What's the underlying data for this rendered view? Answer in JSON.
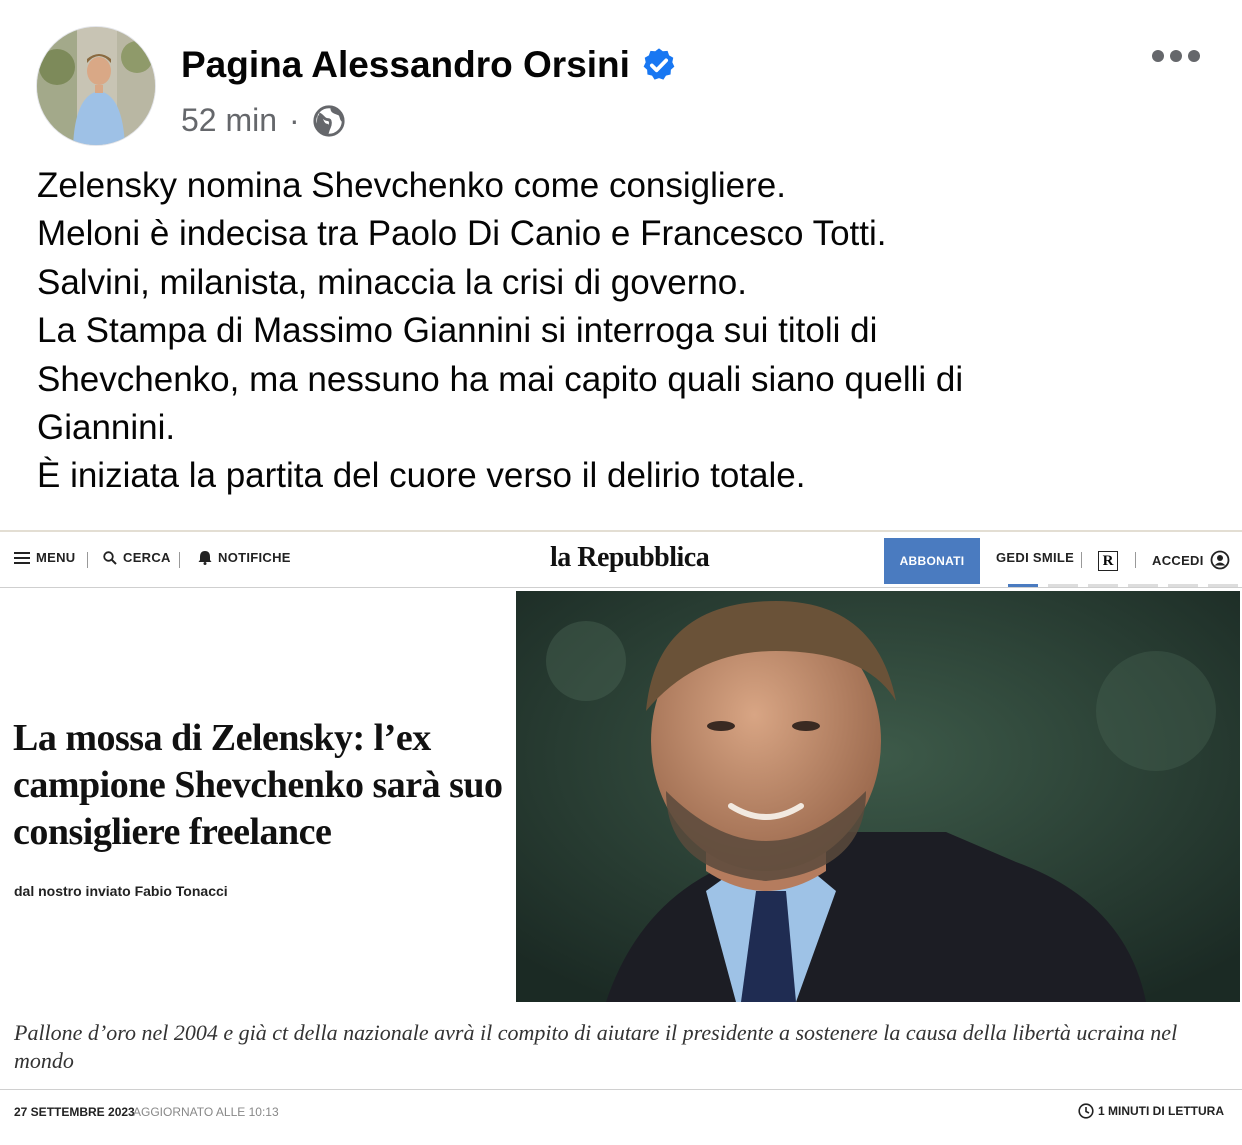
{
  "post": {
    "author": "Pagina Alessandro Orsini",
    "time": "52 min",
    "separator": "·",
    "privacy_icon": "globe-icon",
    "more_icon": "more-options-icon",
    "lines": [
      "Zelensky nomina Shevchenko come consigliere.",
      "Meloni è indecisa tra Paolo Di Canio e Francesco Totti.",
      "Salvini, milanista, minaccia la crisi di governo.",
      "La Stampa di Massimo Giannini si interroga sui titoli di",
      "Shevchenko, ma nessuno ha mai capito quali siano quelli di",
      "Giannini.",
      "È iniziata la partita del cuore verso il delirio totale."
    ]
  },
  "article": {
    "nav": {
      "menu": "MENU",
      "search": "CERCA",
      "notifications": "NOTIFICHE",
      "logo": "la Repubblica",
      "subscribe": "ABBONATI",
      "gedi": "GEDI SMILE",
      "r_badge": "R",
      "login": "ACCEDI"
    },
    "headline": "La mossa di Zelensky: l’ex campione Shevchenko sarà suo consigliere freelance",
    "byline": "dal nostro inviato Fabio Tonacci",
    "subtitle": "Pallone d’oro nel 2004 e già ct della nazionale avrà il compito di aiutare il presidente a sostenere la causa della libertà ucraina nel mondo",
    "date": "27 SETTEMBRE 2023",
    "updated": "AGGIORNATO ALLE 10:13",
    "read_time": "1 MINUTI DI LETTURA"
  },
  "colors": {
    "verified_blue": "#1877f2",
    "subscribe_blue": "#4a7bc0",
    "meta_gray": "#65676b"
  }
}
